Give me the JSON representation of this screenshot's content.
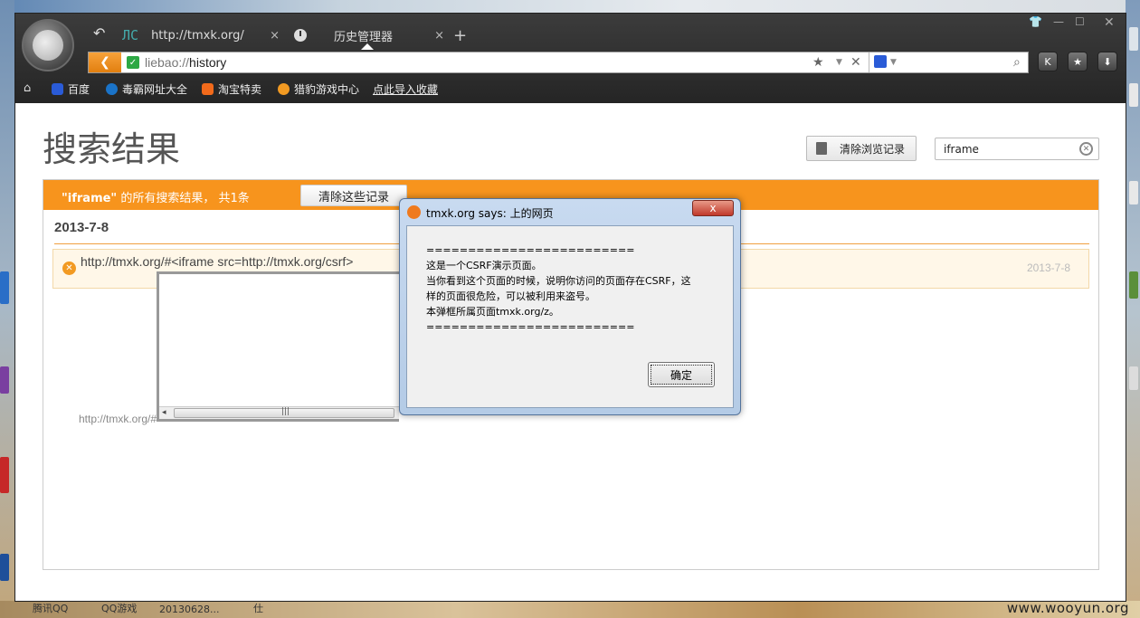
{
  "desktop": {
    "taskbar_labels": [
      "腾讯QQ",
      "QQ游戏",
      "20130628...",
      "仕"
    ],
    "watermark": "www.wooyun.org"
  },
  "browser": {
    "tabs": [
      {
        "label": "http://tmxk.org/",
        "close": "×"
      },
      {
        "label": "历史管理器",
        "close": "×"
      }
    ],
    "new_tab": "+",
    "back_arrow": "↶",
    "address": {
      "scheme": "liebao://",
      "path": "history"
    },
    "bookmarks": [
      "百度",
      "毒霸网址大全",
      "淘宝特卖",
      "猎豹游戏中心",
      "点此导入收藏"
    ],
    "colors": {
      "accent": "#f7941d",
      "chrome": "#2b2b2b"
    }
  },
  "page": {
    "title": "搜索结果",
    "clear_history_label": "清除浏览记录",
    "search_value": "iframe",
    "results_bar": {
      "keyword": "\"iframe\"",
      "text": " 的所有搜索结果， 共1条",
      "clear_button": "清除这些记录"
    },
    "date_header": "2013-7-8",
    "rows": [
      {
        "url": "http://tmxk.org/#<iframe src=http://tmxk.org/csrf>",
        "date": "2013-7-8"
      }
    ],
    "iframe_caption": "http://tmxk.org/#"
  },
  "dialog": {
    "title": "tmxk.org says: 上的网页",
    "close": "x",
    "lines": [
      "=========================",
      "这是一个CSRF演示页面。",
      "当你看到这个页面的时候，说明你访问的页面存在CSRF，这",
      "样的页面很危险，可以被利用来盗号。",
      "本弹框所属页面tmxk.org/z。",
      "========================="
    ],
    "ok": "确定"
  }
}
